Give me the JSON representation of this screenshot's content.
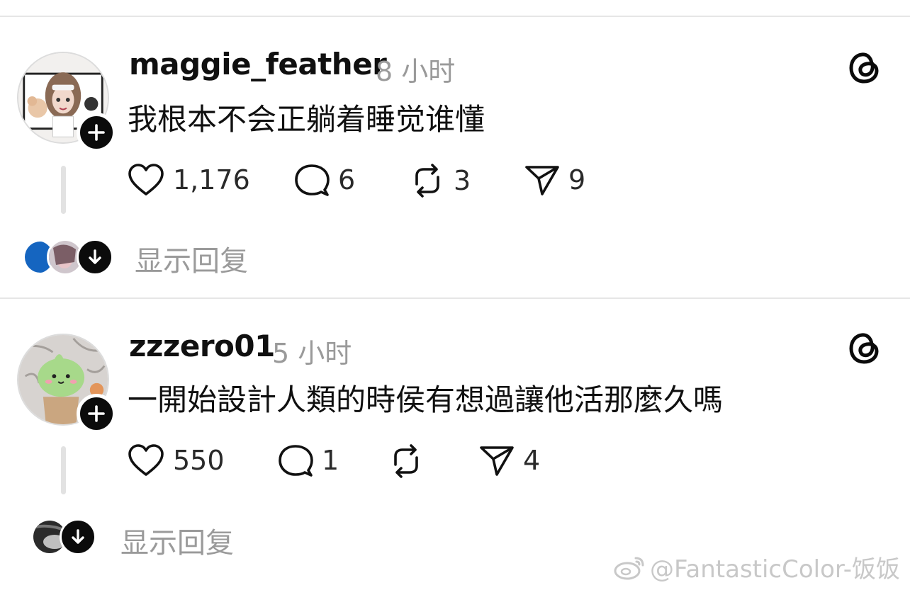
{
  "posts": [
    {
      "username": "maggie_feather",
      "time": "8 小时",
      "text": "我根本不会正躺着睡觉谁懂",
      "likes": "1,176",
      "comments": "6",
      "reposts": "3",
      "shares": "9",
      "show_replies": "显示回复"
    },
    {
      "username": "zzzero01",
      "time": "5 小时",
      "text": "一開始設計人類的時侯有想過讓他活那麼久嗎",
      "likes": "550",
      "comments": "1",
      "reposts": "",
      "shares": "4",
      "show_replies": "显示回复"
    }
  ],
  "watermark": "@FantasticColor-饭饭",
  "icons": {
    "threads": "threads-logo-icon",
    "like": "heart-icon",
    "comment": "comment-bubble-icon",
    "repost": "repost-icon",
    "share": "send-icon",
    "follow": "plus-icon",
    "expand": "arrow-down-icon",
    "watermark": "weibo-icon"
  },
  "colors": {
    "text": "#101010",
    "muted": "#9a9a9a",
    "divider": "#e6e6e6"
  }
}
